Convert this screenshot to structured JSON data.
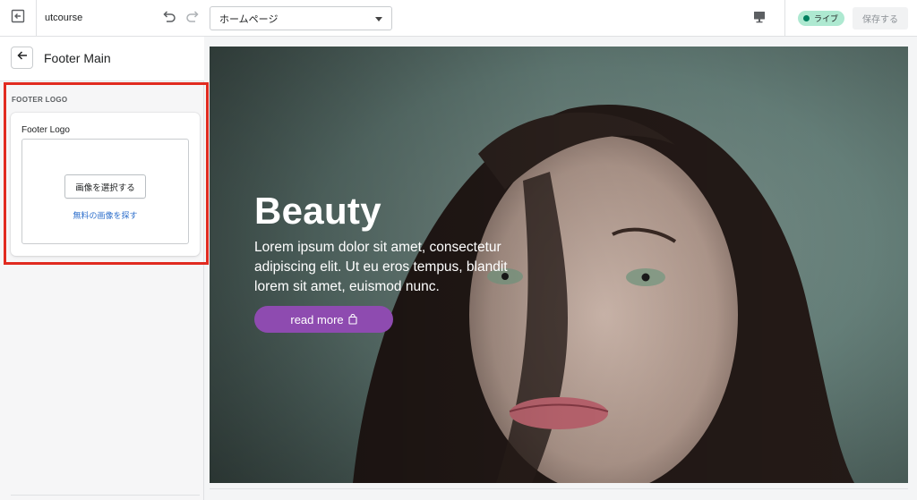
{
  "topbar": {
    "store_name": "utcourse",
    "page_select": {
      "selected": "ホームページ"
    },
    "live_badge": "ライブ",
    "save_label": "保存する"
  },
  "sidebar": {
    "title": "Footer Main",
    "group_label": "FOOTER LOGO",
    "field_label": "Footer Logo",
    "select_image_label": "画像を選択する",
    "free_images_link": "無料の画像を探す"
  },
  "preview": {
    "hero_title": "Beauty",
    "hero_text": "Lorem ipsum dolor sit amet, consectetur adipiscing elit. Ut eu eros tempus, blandit lorem sit amet, euismod nunc.",
    "hero_button": "read more"
  },
  "colors": {
    "accent_live": "#aee9d1",
    "live_dot": "#007f5f",
    "hero_button": "#8e4bb0",
    "highlight": "#e12b20",
    "link": "#2c6ecb"
  },
  "icons": {
    "exit": "exit-icon",
    "undo": "undo-icon",
    "redo": "redo-icon",
    "device": "desktop-icon",
    "back": "arrow-left-icon",
    "bag": "shopping-bag-icon"
  }
}
